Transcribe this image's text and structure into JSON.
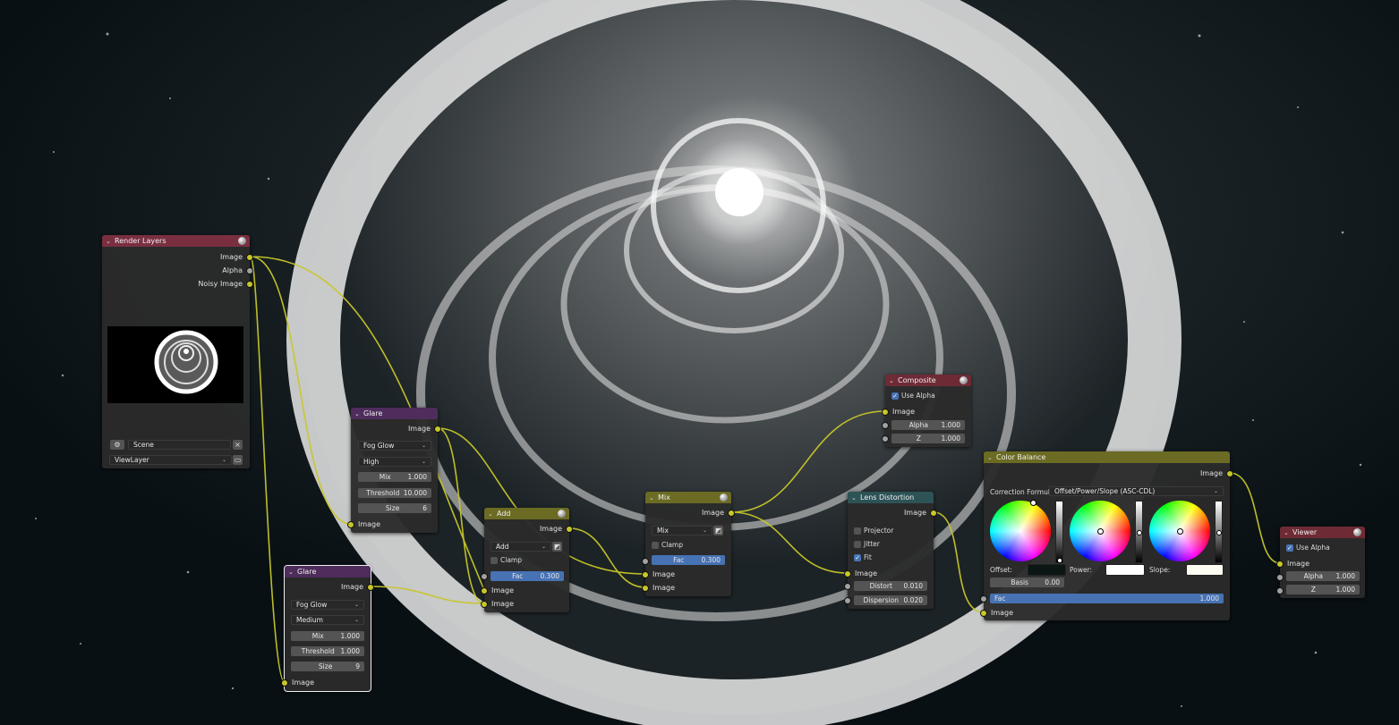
{
  "render_layers": {
    "title": "Render Layers",
    "outputs": [
      "Image",
      "Alpha",
      "Noisy Image"
    ],
    "scene": "Scene",
    "view_layer": "ViewLayer"
  },
  "glare1": {
    "title": "Glare",
    "output": "Image",
    "type": "Fog Glow",
    "quality": "High",
    "mix_label": "Mix",
    "mix": "1.000",
    "threshold_label": "Threshold",
    "threshold": "10.000",
    "size_label": "Size",
    "size": "6",
    "input": "Image"
  },
  "glare2": {
    "title": "Glare",
    "output": "Image",
    "type": "Fog Glow",
    "quality": "Medium",
    "mix_label": "Mix",
    "mix": "1.000",
    "threshold_label": "Threshold",
    "threshold": "1.000",
    "size_label": "Size",
    "size": "9",
    "input": "Image"
  },
  "add": {
    "title": "Add",
    "output": "Image",
    "blend": "Add",
    "clamp": "Clamp",
    "fac_label": "Fac",
    "fac": "0.300",
    "input1": "Image",
    "input2": "Image"
  },
  "mix": {
    "title": "Mix",
    "output": "Image",
    "blend": "Mix",
    "clamp": "Clamp",
    "fac_label": "Fac",
    "fac": "0.300",
    "input1": "Image",
    "input2": "Image"
  },
  "composite": {
    "title": "Composite",
    "use_alpha": "Use Alpha",
    "input": "Image",
    "alpha_label": "Alpha",
    "alpha": "1.000",
    "z_label": "Z",
    "z": "1.000"
  },
  "lens": {
    "title": "Lens Distortion",
    "output": "Image",
    "projector": "Projector",
    "jitter": "Jitter",
    "fit": "Fit",
    "input": "Image",
    "distort_label": "Distort",
    "distort": "0.010",
    "dispersion_label": "Dispersion",
    "dispersion": "0.020"
  },
  "color_balance": {
    "title": "Color Balance",
    "output": "Image",
    "formula_label": "Correction Formula:",
    "formula": "Offset/Power/Slope (ASC-CDL)",
    "offset_label": "Offset:",
    "power_label": "Power:",
    "slope_label": "Slope:",
    "basis_label": "Basis",
    "basis": "0.00",
    "fac_label": "Fac",
    "fac": "1.000",
    "input": "Image"
  },
  "viewer": {
    "title": "Viewer",
    "use_alpha": "Use Alpha",
    "input": "Image",
    "alpha_label": "Alpha",
    "alpha": "1.000",
    "z_label": "Z",
    "z": "1.000"
  },
  "colors": {
    "input_header": "#7a2f40",
    "filter_header": "#4e2d5c",
    "color_header": "#6b6b23",
    "output_header": "#6e2b36",
    "distort_header": "#2d5356",
    "socket_color": "#c7c729",
    "socket_value": "#a1a1a1",
    "field_active": "#4772b3"
  }
}
